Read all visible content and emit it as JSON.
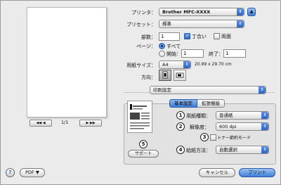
{
  "printer": {
    "label": "プリンタ：",
    "value": "Brother MFC-XXXX",
    "toggle": "▲"
  },
  "preset": {
    "label": "プリセット：",
    "value": "標準"
  },
  "copies": {
    "label": "部数：",
    "value": "1",
    "collate_label": "丁合い",
    "collate_checked": true,
    "duplex_label": "両面",
    "duplex_checked": false
  },
  "pages": {
    "label": "ページ：",
    "all_label": "すべて",
    "from_label": "開始：",
    "from_value": "1",
    "to_label": "終了：",
    "to_value": "1"
  },
  "paper_size": {
    "label": "用紙サイズ：",
    "value": "A4",
    "dimensions": "20.99 x 29.70 cm"
  },
  "orientation": {
    "label": "方向："
  },
  "section_popup": {
    "value": "印刷設定"
  },
  "preview_nav": {
    "prev": "◀◀  ◀",
    "page": "1/1",
    "next": "▶  ▶▶"
  },
  "tabs": [
    {
      "label": "基本設定"
    },
    {
      "label": "拡張機能"
    }
  ],
  "settings": {
    "media_type": {
      "num": "1",
      "label": "用紙種類：",
      "value": "普通紙"
    },
    "resolution": {
      "num": "2",
      "label": "解像度：",
      "value": "600 dpi"
    },
    "toner_save": {
      "num": "3",
      "label": "トナー節約モード"
    },
    "paper_source": {
      "num": "4",
      "label": "給紙方法：",
      "value": "自動選択"
    },
    "support": {
      "num": "5",
      "label": "サポート"
    }
  },
  "footer": {
    "help": "?",
    "pdf": "PDF ▼",
    "cancel": "キャンセル",
    "print": "プリント"
  }
}
